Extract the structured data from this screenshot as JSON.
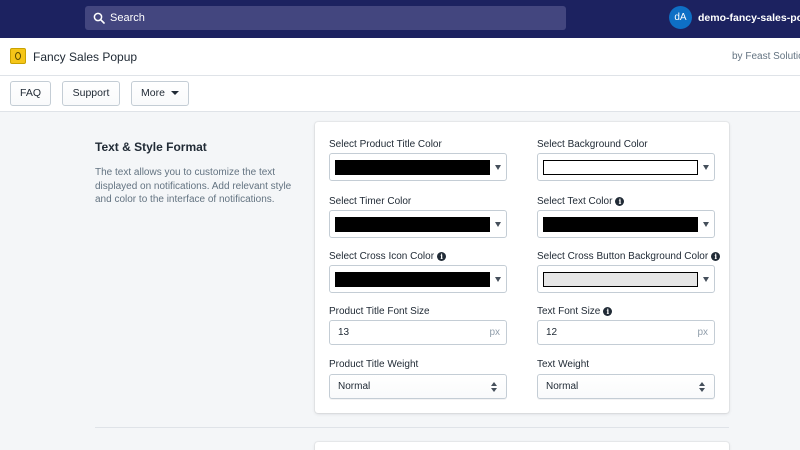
{
  "topbar": {
    "search_label": "Search",
    "avatar_initials": "dA",
    "store_name": "demo-fancy-sales-pop..."
  },
  "app": {
    "title": "Fancy Sales Popup",
    "byline": "by Feast Solutions"
  },
  "nav": {
    "faq": "FAQ",
    "support": "Support",
    "more": "More"
  },
  "section": {
    "title": "Text & Style Format",
    "description": "The text allows you to customize the text displayed on notifications. Add relevant style and color to the interface of notifications."
  },
  "fields": {
    "product_title_color": {
      "label": "Select Product Title Color",
      "value": "#000000"
    },
    "background_color": {
      "label": "Select Background Color",
      "value": "#ffffff"
    },
    "timer_color": {
      "label": "Select Timer Color",
      "value": "#000000"
    },
    "text_color": {
      "label": "Select Text Color",
      "value": "#000000"
    },
    "cross_icon_color": {
      "label": "Select Cross Icon Color",
      "value": "#000000"
    },
    "cross_button_bg_color": {
      "label": "Select Cross Button Background Color",
      "value": "#e6e6e6"
    },
    "product_title_font_size": {
      "label": "Product Title Font Size",
      "value": "13",
      "suffix": "px"
    },
    "text_font_size": {
      "label": "Text Font Size",
      "value": "12",
      "suffix": "px"
    },
    "product_title_weight": {
      "label": "Product Title Weight",
      "value": "Normal"
    },
    "text_weight": {
      "label": "Text Weight",
      "value": "Normal"
    }
  },
  "colors": {
    "topbar": "#1c2260",
    "search_bg": "#43467f",
    "avatar": "#0e6fc5"
  }
}
